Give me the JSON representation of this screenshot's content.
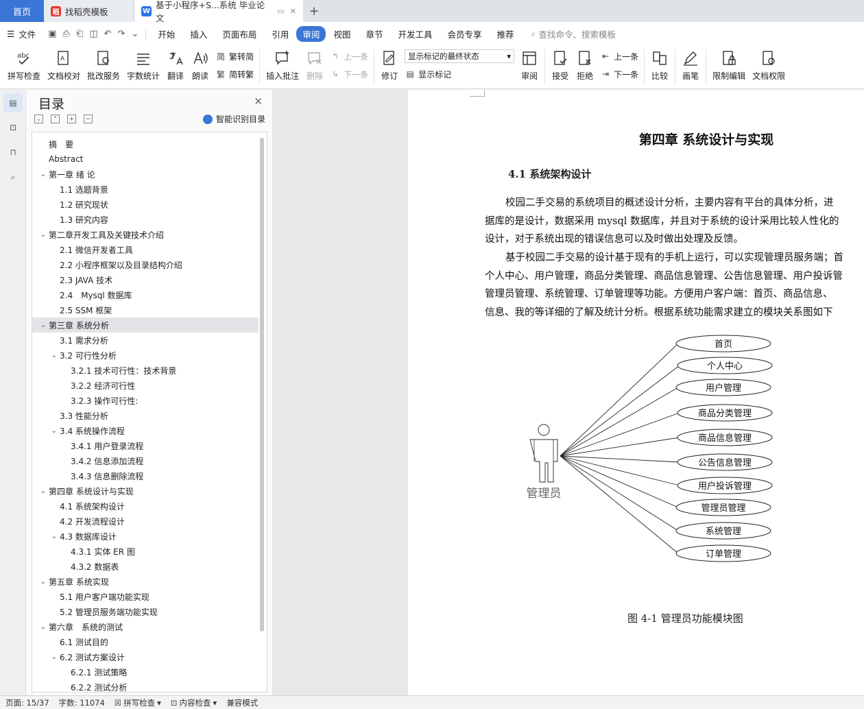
{
  "tabs": {
    "home": "首页",
    "t1": "找稻壳模板",
    "t2": "基于小程序+S...系统 毕业论文"
  },
  "menu": {
    "file": "文件",
    "items": [
      "开始",
      "插入",
      "页面布局",
      "引用",
      "审阅",
      "视图",
      "章节",
      "开发工具",
      "会员专享",
      "推荐"
    ],
    "active": "审阅",
    "search": "查找命令、搜索模板"
  },
  "ribbon": {
    "spell": "拼写检查",
    "proof": "文档校对",
    "batch": "批改服务",
    "wordcount": "字数统计",
    "translate": "翻译",
    "read": "朗读",
    "t2s": "繁转简",
    "s2t": "简转繁",
    "insert_comment": "插入批注",
    "delete": "删除",
    "prev": "上一条",
    "next": "下一条",
    "revise": "修订",
    "markup_state": "显示标记的最终状态",
    "show_markup": "显示标记",
    "review": "审阅",
    "accept": "接受",
    "reject": "拒绝",
    "prev2": "上一条",
    "next2": "下一条",
    "compare": "比较",
    "pen": "画笔",
    "restrict": "限制编辑",
    "rights": "文档权限"
  },
  "toc": {
    "title": "目录",
    "smart": "智能识别目录",
    "items": [
      {
        "text": "摘　要",
        "level": 1,
        "tog": ""
      },
      {
        "text": "Abstract",
        "level": 1,
        "tog": ""
      },
      {
        "text": "第一章 绪 论",
        "level": 1,
        "tog": "v"
      },
      {
        "text": "1.1 选题背景",
        "level": 2,
        "tog": ""
      },
      {
        "text": "1.2 研究现状",
        "level": 2,
        "tog": ""
      },
      {
        "text": "1.3 研究内容",
        "level": 2,
        "tog": ""
      },
      {
        "text": "第二章开发工具及关键技术介绍",
        "level": 1,
        "tog": "v"
      },
      {
        "text": "2.1 微信开发者工具",
        "level": 2,
        "tog": ""
      },
      {
        "text": "2.2 小程序框架以及目录结构介绍",
        "level": 2,
        "tog": ""
      },
      {
        "text": "2.3 JAVA 技术",
        "level": 2,
        "tog": ""
      },
      {
        "text": "2.4　Mysql 数据库",
        "level": 2,
        "tog": ""
      },
      {
        "text": "2.5 SSM 框架",
        "level": 2,
        "tog": ""
      },
      {
        "text": "第三章 系统分析",
        "level": 1,
        "tog": "v",
        "cur": true
      },
      {
        "text": "3.1 需求分析",
        "level": 2,
        "tog": ""
      },
      {
        "text": "3.2 可行性分析",
        "level": 2,
        "tog": "v"
      },
      {
        "text": "3.2.1 技术可行性：技术背景",
        "level": 3,
        "tog": ""
      },
      {
        "text": "3.2.2 经济可行性",
        "level": 3,
        "tog": ""
      },
      {
        "text": "3.2.3 操作可行性:",
        "level": 3,
        "tog": ""
      },
      {
        "text": "3.3 性能分析",
        "level": 2,
        "tog": ""
      },
      {
        "text": "3.4 系统操作流程",
        "level": 2,
        "tog": "v"
      },
      {
        "text": "3.4.1 用户登录流程",
        "level": 3,
        "tog": ""
      },
      {
        "text": "3.4.2 信息添加流程",
        "level": 3,
        "tog": ""
      },
      {
        "text": "3.4.3 信息删除流程",
        "level": 3,
        "tog": ""
      },
      {
        "text": "第四章 系统设计与实现",
        "level": 1,
        "tog": "v"
      },
      {
        "text": "4.1 系统架构设计",
        "level": 2,
        "tog": ""
      },
      {
        "text": "4.2 开发流程设计",
        "level": 2,
        "tog": ""
      },
      {
        "text": "4.3 数据库设计",
        "level": 2,
        "tog": "v"
      },
      {
        "text": "4.3.1 实体 ER 图",
        "level": 3,
        "tog": ""
      },
      {
        "text": "4.3.2 数据表",
        "level": 3,
        "tog": ""
      },
      {
        "text": "第五章 系统实现",
        "level": 1,
        "tog": "v"
      },
      {
        "text": "5.1 用户客户端功能实现",
        "level": 2,
        "tog": ""
      },
      {
        "text": "5.2 管理员服务端功能实现",
        "level": 2,
        "tog": ""
      },
      {
        "text": "第六章　系统的测试",
        "level": 1,
        "tog": "v"
      },
      {
        "text": "6.1 测试目的",
        "level": 2,
        "tog": ""
      },
      {
        "text": "6.2 测试方案设计",
        "level": 2,
        "tog": "v"
      },
      {
        "text": "6.2.1 测试策略",
        "level": 3,
        "tog": ""
      },
      {
        "text": "6.2.2 测试分析",
        "level": 3,
        "tog": ""
      }
    ]
  },
  "doc": {
    "chapter": "第四章  系统设计与实现",
    "section": "4.1 系统架构设计",
    "para1": [
      "校园二手交易的系统项目的概述设计分析，主要内容有平台的具体分析，进",
      "据库的是设计，数据采用 mysql 数据库，并且对于系统的设计采用比较人性化的",
      "设计，对于系统出现的错误信息可以及时做出处理及反馈。"
    ],
    "para2": [
      "基于校园二手交易的设计基于现有的手机上运行，可以实现管理员服务端；首",
      "个人中心、用户管理，商品分类管理、商品信息管理、公告信息管理、用户投诉管",
      "管理员管理、系统管理、订单管理等功能。方便用户客户端：首页、商品信息、",
      "信息、我的等详细的了解及统计分析。根据系统功能需求建立的模块关系图如下"
    ],
    "actor": "管理员",
    "modules": [
      "首页",
      "个人中心",
      "用户管理",
      "商品分类管理",
      "商品信息管理",
      "公告信息管理",
      "用户投诉管理",
      "管理员管理",
      "系统管理",
      "订单管理"
    ],
    "caption": "图 4-1 管理员功能模块图"
  },
  "status": {
    "page": "页面: 15/37",
    "words": "字数: 11074",
    "spell": "拼写检查",
    "content": "内容检查",
    "compat": "兼容模式"
  }
}
